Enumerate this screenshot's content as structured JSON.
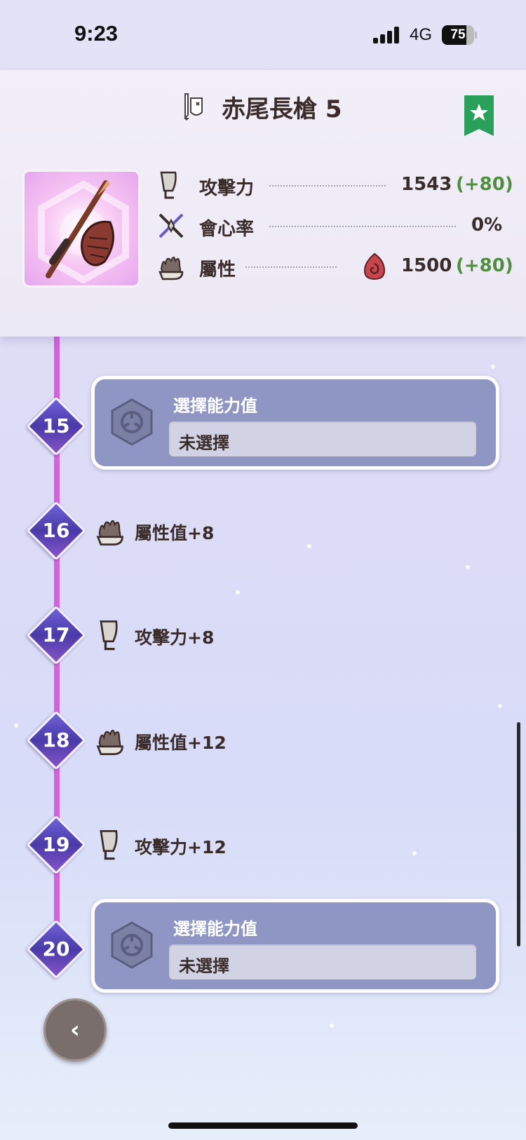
{
  "status": {
    "time": "9:23",
    "network": "4G",
    "battery": "75",
    "battery_level": 0.75
  },
  "header": {
    "title": "赤尾長槍 5",
    "stats": [
      {
        "label": "攻擊力",
        "value": "1543",
        "bonus": "(+80)"
      },
      {
        "label": "會心率",
        "value": "0%",
        "bonus": ""
      },
      {
        "label": "屬性",
        "value": "1500",
        "bonus": "(+80)"
      }
    ]
  },
  "timeline": {
    "levels": [
      {
        "num": "15",
        "kind": "select",
        "title": "選擇能力值",
        "field": "未選擇"
      },
      {
        "num": "16",
        "kind": "bonus",
        "icon": "element-icon",
        "text": "屬性值+8"
      },
      {
        "num": "17",
        "kind": "bonus",
        "icon": "attack-icon",
        "text": "攻擊力+8"
      },
      {
        "num": "18",
        "kind": "bonus",
        "icon": "element-icon",
        "text": "屬性值+12"
      },
      {
        "num": "19",
        "kind": "bonus",
        "icon": "attack-icon",
        "text": "攻擊力+12"
      },
      {
        "num": "20",
        "kind": "select",
        "title": "選擇能力值",
        "field": "未選擇"
      }
    ]
  },
  "colors": {
    "accent": "#d660e0",
    "bonus_green": "#4f8e3c",
    "bookmark": "#2aa15a",
    "card": "#8f96c4"
  }
}
